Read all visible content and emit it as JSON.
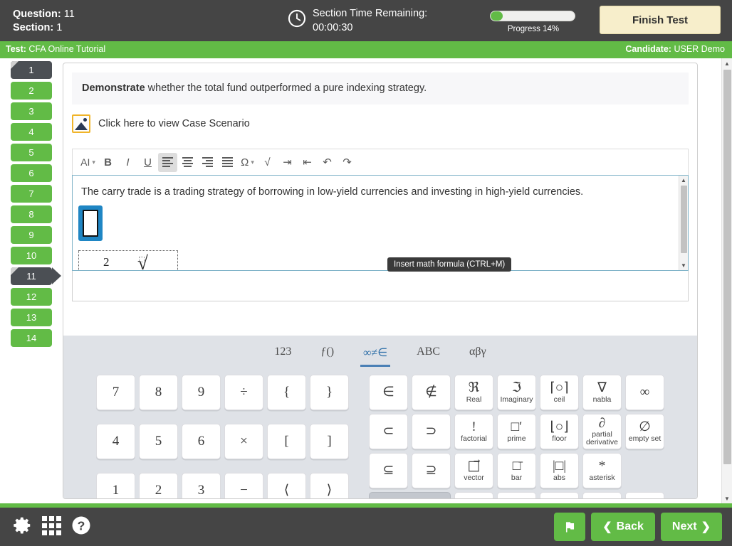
{
  "header": {
    "question_label": "Question:",
    "question_value": "11",
    "section_label": "Section:",
    "section_value": "1",
    "clock_icon": "clock-icon",
    "timer_label": "Section Time Remaining:",
    "timer_value": "00:00:30",
    "progress_text": "Progress 14%",
    "progress_percent": 14,
    "finish_label": "Finish Test"
  },
  "infobar": {
    "test_label": "Test:",
    "test_name": "CFA Online Tutorial",
    "candidate_label": "Candidate:",
    "candidate_name": "USER Demo"
  },
  "nav": {
    "items": [
      {
        "label": "1",
        "state": "answered-dark"
      },
      {
        "label": "2",
        "state": "answered"
      },
      {
        "label": "3",
        "state": "answered"
      },
      {
        "label": "4",
        "state": "answered"
      },
      {
        "label": "5",
        "state": "answered"
      },
      {
        "label": "6",
        "state": "answered"
      },
      {
        "label": "7",
        "state": "answered"
      },
      {
        "label": "8",
        "state": "answered"
      },
      {
        "label": "9",
        "state": "answered"
      },
      {
        "label": "10",
        "state": "answered"
      },
      {
        "label": "11",
        "state": "current"
      },
      {
        "label": "12",
        "state": "answered"
      },
      {
        "label": "13",
        "state": "answered"
      },
      {
        "label": "14",
        "state": "answered"
      }
    ]
  },
  "question": {
    "stem_bold": "Demonstrate",
    "stem_rest": " whether the total fund outperformed a pure indexing strategy.",
    "case_icon": "image-icon",
    "case_link": "Click here to view Case Scenario"
  },
  "editor": {
    "toolbar": [
      {
        "name": "ai-menu",
        "label": "AI",
        "caret": true,
        "active": false
      },
      {
        "name": "bold",
        "label": "B",
        "caret": false,
        "active": false
      },
      {
        "name": "italic",
        "label": "I",
        "caret": false,
        "active": false
      },
      {
        "name": "underline",
        "label": "U",
        "caret": false,
        "active": false
      },
      {
        "name": "align-left",
        "label": "",
        "caret": false,
        "active": true
      },
      {
        "name": "align-center",
        "label": "",
        "caret": false,
        "active": false
      },
      {
        "name": "align-right",
        "label": "",
        "caret": false,
        "active": false
      },
      {
        "name": "align-justify",
        "label": "",
        "caret": false,
        "active": false
      },
      {
        "name": "special-char",
        "label": "Ω",
        "caret": true,
        "active": false
      },
      {
        "name": "math-formula",
        "label": "√",
        "caret": false,
        "active": false
      },
      {
        "name": "indent",
        "label": "⇥",
        "caret": false,
        "active": false
      },
      {
        "name": "outdent",
        "label": "⇤",
        "caret": false,
        "active": false
      },
      {
        "name": "undo",
        "label": "↶",
        "caret": false,
        "active": false
      },
      {
        "name": "redo",
        "label": "↷",
        "caret": false,
        "active": false
      }
    ],
    "body_text": "The carry trade is a trading strategy of borrowing in low-yield currencies and investing in high-yield currencies.",
    "math_fragment_number": "2",
    "math_fragment_radical": "√",
    "tooltip": "Insert math formula (CTRL+M)"
  },
  "keyboard": {
    "tabs": [
      {
        "label": "123",
        "active": false
      },
      {
        "label": "ƒ()",
        "active": false
      },
      {
        "label": "∞≠∈",
        "active": true
      },
      {
        "label": "ABC",
        "active": false
      },
      {
        "label": "αβγ",
        "active": false
      }
    ],
    "left_keys": [
      {
        "glyph": "7",
        "cap": "",
        "name": "key-7"
      },
      {
        "glyph": "8",
        "cap": "",
        "name": "key-8"
      },
      {
        "glyph": "9",
        "cap": "",
        "name": "key-9"
      },
      {
        "glyph": "÷",
        "cap": "",
        "name": "key-divide"
      },
      {
        "glyph": "{",
        "cap": "",
        "name": "key-brace-open"
      },
      {
        "glyph": "}",
        "cap": "",
        "name": "key-brace-close"
      },
      {
        "glyph": "4",
        "cap": "",
        "name": "key-4"
      },
      {
        "glyph": "5",
        "cap": "",
        "name": "key-5"
      },
      {
        "glyph": "6",
        "cap": "",
        "name": "key-6"
      },
      {
        "glyph": "×",
        "cap": "",
        "name": "key-multiply"
      },
      {
        "glyph": "[",
        "cap": "",
        "name": "key-bracket-open"
      },
      {
        "glyph": "]",
        "cap": "",
        "name": "key-bracket-close"
      },
      {
        "glyph": "1",
        "cap": "",
        "name": "key-1"
      },
      {
        "glyph": "2",
        "cap": "",
        "name": "key-2"
      },
      {
        "glyph": "3",
        "cap": "",
        "name": "key-3"
      },
      {
        "glyph": "−",
        "cap": "",
        "name": "key-minus"
      },
      {
        "glyph": "⟨",
        "cap": "",
        "name": "key-angle-open"
      },
      {
        "glyph": "⟩",
        "cap": "",
        "name": "key-angle-close"
      }
    ],
    "right_keys": [
      {
        "glyph": "∈",
        "cap": "",
        "name": "key-element-of"
      },
      {
        "glyph": "∉",
        "cap": "",
        "name": "key-not-element-of"
      },
      {
        "glyph": "ℜ",
        "cap": "Real",
        "name": "key-real"
      },
      {
        "glyph": "ℑ",
        "cap": "Imaginary",
        "name": "key-imaginary"
      },
      {
        "glyph": "⌈○⌉",
        "cap": "ceil",
        "name": "key-ceil"
      },
      {
        "glyph": "∇",
        "cap": "nabla",
        "name": "key-nabla"
      },
      {
        "glyph": "∞",
        "cap": "",
        "name": "key-infinity"
      },
      {
        "glyph": "⊂",
        "cap": "",
        "name": "key-subset"
      },
      {
        "glyph": "⊃",
        "cap": "",
        "name": "key-superset"
      },
      {
        "glyph": "!",
        "cap": "factorial",
        "name": "key-factorial"
      },
      {
        "glyph": "□′",
        "cap": "prime",
        "name": "key-prime"
      },
      {
        "glyph": "⌊○⌋",
        "cap": "floor",
        "name": "key-floor"
      },
      {
        "glyph": "∂",
        "cap": "partial derivative",
        "name": "key-partial-derivative"
      },
      {
        "glyph": "∅",
        "cap": "empty set",
        "name": "key-empty-set"
      },
      {
        "glyph": "⊆",
        "cap": "",
        "name": "key-subset-equal"
      },
      {
        "glyph": "⊇",
        "cap": "",
        "name": "key-superset-equal"
      },
      {
        "glyph": "□⃗",
        "cap": "vector",
        "name": "key-vector"
      },
      {
        "glyph": "□̄",
        "cap": "bar",
        "name": "key-bar"
      },
      {
        "glyph": "|□|",
        "cap": "abs",
        "name": "key-abs"
      },
      {
        "glyph": "*",
        "cap": "asterisk",
        "name": "key-asterisk"
      },
      {
        "glyph": "⌫",
        "cap": "",
        "name": "key-backspace"
      }
    ]
  },
  "footer": {
    "settings_icon": "gear-icon",
    "grid_icon": "grid-icon",
    "help_icon": "help-icon",
    "flag_icon": "flag-icon",
    "back_label": "Back",
    "next_label": "Next"
  },
  "colors": {
    "green": "#62bb46",
    "dark": "#454545",
    "cream": "#f7eecb",
    "editor_border": "#7fb3c8",
    "tab_blue": "#2c6ea8"
  }
}
